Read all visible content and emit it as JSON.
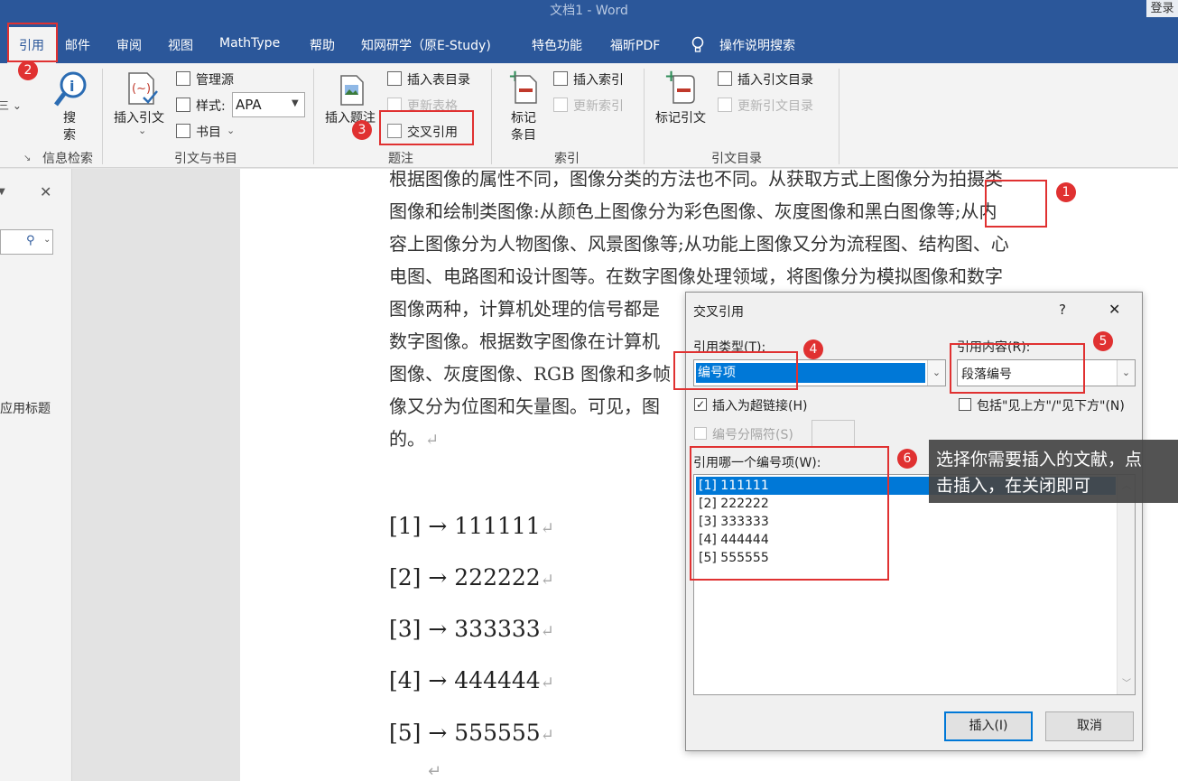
{
  "window": {
    "title": "文档1 - Word",
    "login": "登录"
  },
  "tabs": [
    "引用",
    "邮件",
    "审阅",
    "视图",
    "MathType",
    "帮助",
    "知网研学（原E-Study)",
    "特色功能",
    "福昕PDF",
    "操作说明搜索"
  ],
  "ribbon": {
    "search": {
      "label_1": "搜",
      "label_2": "索",
      "group": "信息检索"
    },
    "citations": {
      "insert_citation": "插入引文",
      "manage_sources": "管理源",
      "style_label": "样式:",
      "style_value": "APA",
      "bibliography": "书目",
      "group": "引文与书目"
    },
    "captions": {
      "insert_caption": "插入题注",
      "insert_table_of_figures": "插入表目录",
      "update_table": "更新表格",
      "cross_reference": "交叉引用",
      "group": "题注"
    },
    "index": {
      "mark_entry_1": "标记",
      "mark_entry_2": "条目",
      "insert_index": "插入索引",
      "update_index": "更新索引",
      "group": "索引"
    },
    "toa": {
      "mark_citation": "标记引文",
      "insert_toa": "插入引文目录",
      "update_toa": "更新引文目录",
      "group": "引文目录"
    }
  },
  "navpane": {
    "heading_hint": "应用标题"
  },
  "document": {
    "lines": [
      "根据图像的属性不同，图像分类的方法也不同。从获取方式上图像分为拍摄类",
      "图像和绘制类图像:从颜色上图像分为彩色图像、灰度图像和黑白图像等;从内",
      "容上图像分为人物图像、风景图像等;从功能上图像又分为流程图、结构图、心",
      "电图、电路图和设计图等。在数字图像处理领域，将图像分为模拟图像和数字",
      "图像两种，计算机处理的信号都是",
      "数字图像。根据数字图像在计算机",
      "图像、灰度图像、RGB 图像和多帧",
      "像又分为位图和矢量图。可见，图",
      "的。"
    ],
    "references": [
      "[1] → 111111",
      "[2] → 222222",
      "[3] → 333333",
      "[4] → 444444",
      "[5] → 555555"
    ],
    "paragraph_mark": "↵"
  },
  "dialog": {
    "title": "交叉引用",
    "help": "?",
    "close": "✕",
    "ref_type_label": "引用类型(T):",
    "ref_type_value": "编号项",
    "ref_content_label": "引用内容(R):",
    "ref_content_value": "段落编号",
    "insert_hyperlink": "插入为超链接(H)",
    "include_above_below": "包括\"见上方\"/\"见下方\"(N)",
    "separate_numbers": "编号分隔符(S)",
    "which_item_label": "引用哪一个编号项(W):",
    "items": [
      "[1] 111111",
      "[2] 222222",
      "[3] 333333",
      "[4] 444444",
      "[5] 555555"
    ],
    "insert_button": "插入(I)",
    "cancel_button": "取消"
  },
  "annotations": {
    "badges": [
      "1",
      "2",
      "3",
      "4",
      "5",
      "6"
    ],
    "tooltip_line1": "选择你需要插入的文献，点",
    "tooltip_line2": "击插入，在关闭即可",
    "color": "#e03131"
  },
  "colors": {
    "title_bar": "#2b579a",
    "selection": "#0078d7"
  }
}
